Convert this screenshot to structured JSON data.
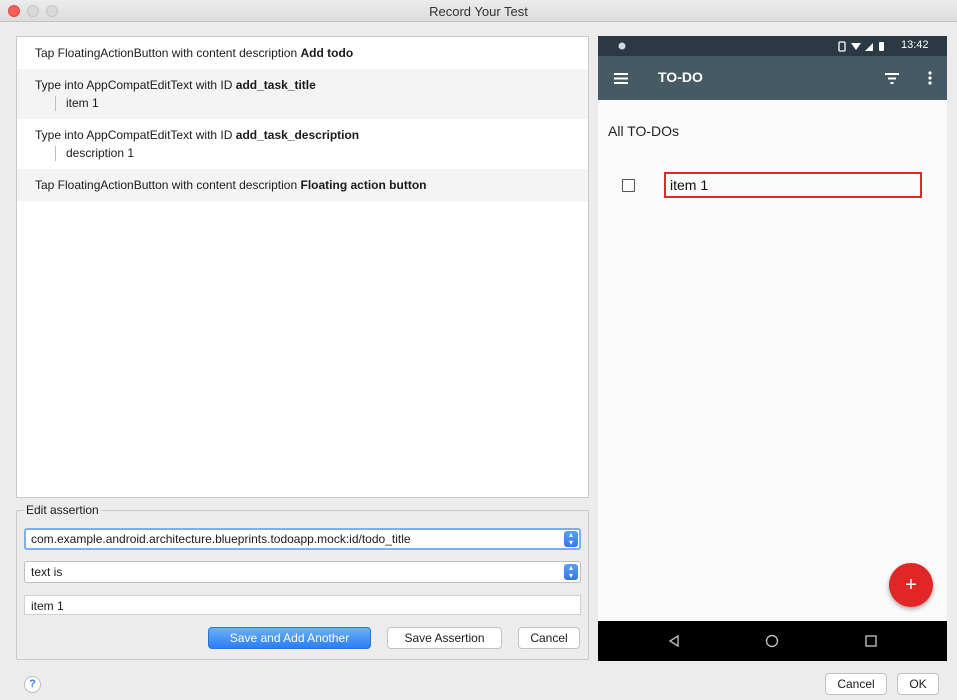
{
  "window": {
    "title": "Record Your Test"
  },
  "steps": [
    {
      "prefix": "Tap FloatingActionButton with content description ",
      "target": "Add todo",
      "detail": ""
    },
    {
      "prefix": "Type into AppCompatEditText with ID ",
      "target": "add_task_title",
      "detail": "item 1"
    },
    {
      "prefix": "Type into AppCompatEditText with ID ",
      "target": "add_task_description",
      "detail": "description 1"
    },
    {
      "prefix": "Tap FloatingActionButton with content description ",
      "target": "Floating action button",
      "detail": ""
    }
  ],
  "assertion": {
    "legend": "Edit assertion",
    "view_id": "com.example.android.architecture.blueprints.todoapp.mock:id/todo_title",
    "condition": "text is",
    "value": "item 1",
    "save_add_label": "Save and Add Another",
    "save_label": "Save Assertion",
    "cancel_label": "Cancel"
  },
  "device": {
    "status_time": "13:42",
    "app_title": "TO-DO",
    "section_title": "All TO-DOs",
    "task_title": "item 1",
    "fab_symbol": "+",
    "icons": [
      "hamburger-menu-icon",
      "filter-icon",
      "overflow-menu-icon",
      "back-icon",
      "home-icon",
      "recents-icon"
    ]
  },
  "dialog": {
    "help_label": "?",
    "cancel_label": "Cancel",
    "ok_label": "OK"
  },
  "colors": {
    "app_bar": "#455a64",
    "status_bar": "#2b3a42",
    "fab": "#e02626",
    "highlight": "#e02a2a",
    "primary_button": "#2b7ef2"
  }
}
